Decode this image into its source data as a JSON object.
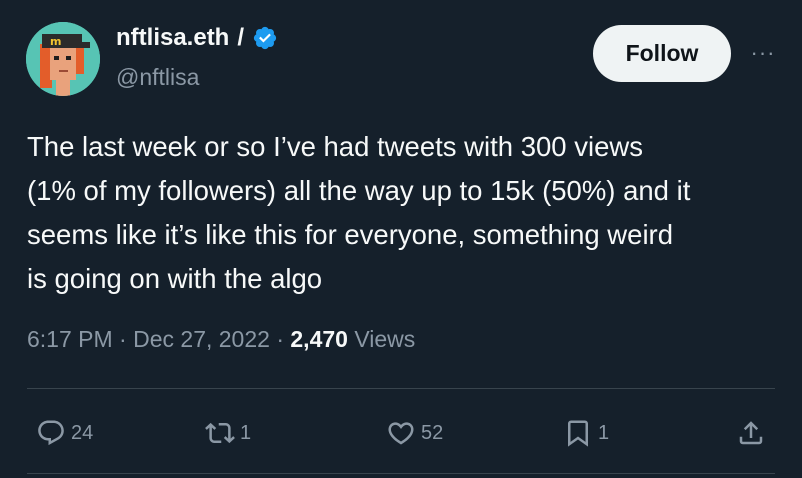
{
  "author": {
    "display_name": "nftlisa.eth",
    "separator": "/",
    "handle": "@nftlisa",
    "verified_icon": "verified-badge-icon"
  },
  "buttons": {
    "follow_label": "Follow",
    "more_label": "···"
  },
  "tweet": {
    "lines": [
      "The last week or so I’ve had tweets with 300 views",
      "(1% of my followers) all the way up to 15k (50%) and it",
      "seems like it’s like this for everyone, something weird",
      "is going on with the algo"
    ],
    "time": "6:17 PM",
    "dot1": "·",
    "date": "Dec 27, 2022",
    "dot2": "·",
    "views_count": "2,470",
    "views_label": "Views"
  },
  "actions": {
    "replies": "24",
    "retweets": "1",
    "likes": "52",
    "bookmarks": "1"
  },
  "colors": {
    "background": "#15202b",
    "text": "#f7f9f9",
    "secondary": "#8b98a5",
    "verified": "#1d9bf0"
  }
}
